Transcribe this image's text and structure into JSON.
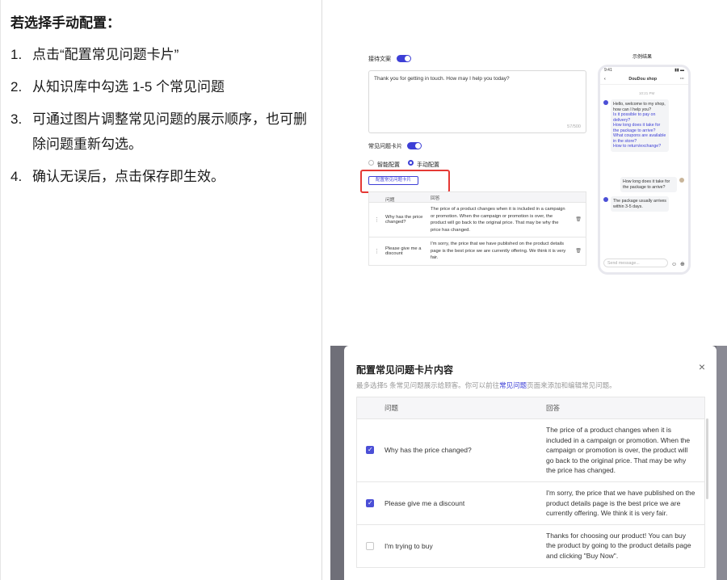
{
  "instructions": {
    "title": "若选择手动配置：",
    "steps": [
      {
        "num": "1.",
        "text": "点击“配置常见问题卡片”"
      },
      {
        "num": "2.",
        "text": "从知识库中勾选 1-5 个常见问题"
      },
      {
        "num": "3.",
        "text": "可通过图片调整常见问题的展示顺序，也可删除问题重新勾选。"
      },
      {
        "num": "4.",
        "text": "确认无误后，点击保存即生效。"
      }
    ]
  },
  "settings": {
    "greeting_label": "接待文案",
    "greeting_text": "Thank you for getting in touch. How may I help you today?",
    "greeting_count": "57/500",
    "faq_card_label": "常见问题卡片",
    "mode_smart": "智能配置",
    "mode_manual": "手动配置",
    "configure_button": "配置常见问题卡片",
    "table_header_question": "问题",
    "table_header_answer": "回答",
    "rows": [
      {
        "q": "Why has the price changed?",
        "a": "The price of a product changes when it is included in a campaign or promotion. When the campaign or promotion is over, the product will go back to the original price. That may be why the price has changed."
      },
      {
        "q": "Please give me a discount",
        "a": "I'm sorry, the price that we have published on the product details page is the best price we are currently offering. We think it is very fair."
      }
    ]
  },
  "preview": {
    "label": "示例结果",
    "time": "9:41",
    "shop": "DouDou shop",
    "chat_time": "10:21 PM",
    "welcome": "Hello, welcome to my shop, how can I help you?",
    "links": [
      "Is it possible to pay on delivery?",
      "How long does it take for the package to arrive?",
      "What coupons are available in the store?",
      "How to return/exchange?"
    ],
    "user_msg": "How long does it take for the package to arrive?",
    "reply": "The package usually arrives within 3-5 days.",
    "input_placeholder": "Send message..."
  },
  "modal": {
    "title": "配置常见问题卡片内容",
    "subtitle_pre": "最多选择5 条常见问题展示给顾客。你可以前往",
    "subtitle_link": "常见问题",
    "subtitle_post": "页面来添加和编辑常见问题。",
    "close": "×",
    "header_question": "问题",
    "header_answer": "回答",
    "rows": [
      {
        "checked": true,
        "q": "Why has the price changed?",
        "a": "The price of a product changes when it is included in a campaign or promotion. When the campaign or promotion is over, the product will go back to the original price. That may be why the price has changed."
      },
      {
        "checked": true,
        "q": "Please give me a discount",
        "a": "I'm sorry, the price that we have published on the product details page is the best price we are currently offering. We think it is very fair."
      },
      {
        "checked": false,
        "q": "I'm trying to buy",
        "a": "Thanks for choosing our product! You can buy the product by going to the product details page and clicking \"Buy Now\"."
      }
    ]
  }
}
